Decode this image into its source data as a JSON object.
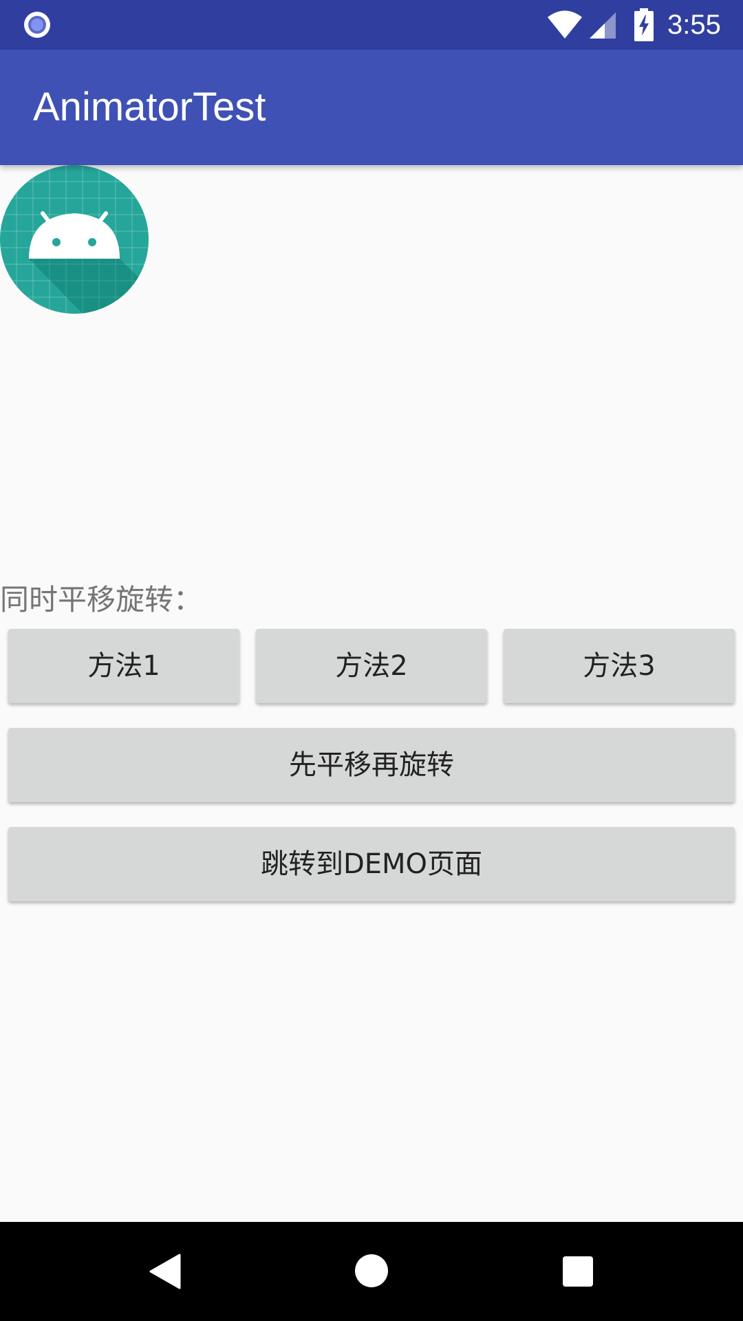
{
  "status_bar": {
    "time": "3:55",
    "icons": [
      "notification-icon",
      "wifi-icon",
      "cell-signal-icon",
      "battery-charging-icon"
    ]
  },
  "app_bar": {
    "title": "AnimatorTest"
  },
  "main": {
    "image": "android-launcher-icon",
    "section_label": "同时平移旋转：",
    "method_buttons": [
      {
        "label": "方法1"
      },
      {
        "label": "方法2"
      },
      {
        "label": "方法3"
      }
    ],
    "sequence_button": "先平移再旋转",
    "demo_button": "跳转到DEMO页面"
  },
  "nav_bar": {
    "icons": [
      "back-icon",
      "home-icon",
      "recents-icon"
    ]
  },
  "colors": {
    "status_bar": "#303f9f",
    "app_bar": "#3f51b5",
    "background": "#fafafa",
    "button": "#d6d7d7",
    "label_text": "#757575",
    "icon_teal": "#26a69a"
  }
}
